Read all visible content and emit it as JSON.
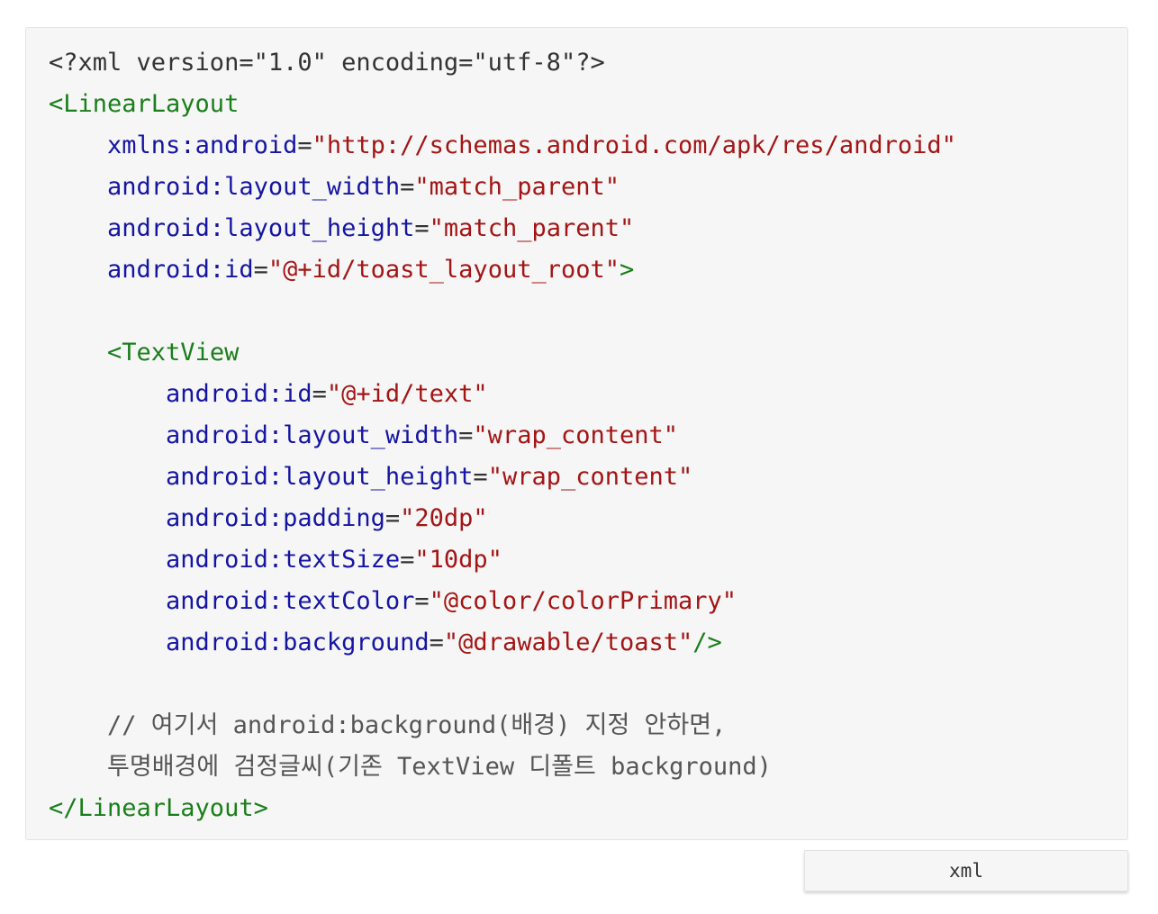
{
  "code_block": {
    "language": "xml",
    "colors": {
      "background": "#f6f6f6",
      "plain": "#333333",
      "tag": "#1a7f1a",
      "attribute": "#1515a3",
      "string": "#a31515",
      "comment": "#555555"
    },
    "lines": [
      [
        {
          "t": "plain",
          "v": "<?xml version=\"1.0\" encoding=\"utf-8\"?>"
        }
      ],
      [
        {
          "t": "tag",
          "v": "<LinearLayout"
        }
      ],
      [
        {
          "t": "plain",
          "v": "    "
        },
        {
          "t": "attr",
          "v": "xmlns:android"
        },
        {
          "t": "plain",
          "v": "="
        },
        {
          "t": "str",
          "v": "\"http://schemas.android.com/apk/res/android\""
        }
      ],
      [
        {
          "t": "plain",
          "v": "    "
        },
        {
          "t": "attr",
          "v": "android:layout_width"
        },
        {
          "t": "plain",
          "v": "="
        },
        {
          "t": "str",
          "v": "\"match_parent\""
        }
      ],
      [
        {
          "t": "plain",
          "v": "    "
        },
        {
          "t": "attr",
          "v": "android:layout_height"
        },
        {
          "t": "plain",
          "v": "="
        },
        {
          "t": "str",
          "v": "\"match_parent\""
        }
      ],
      [
        {
          "t": "plain",
          "v": "    "
        },
        {
          "t": "attr",
          "v": "android:id"
        },
        {
          "t": "plain",
          "v": "="
        },
        {
          "t": "str",
          "v": "\"@+id/toast_layout_root\""
        },
        {
          "t": "tag",
          "v": ">"
        }
      ],
      [],
      [
        {
          "t": "plain",
          "v": "    "
        },
        {
          "t": "tag",
          "v": "<TextView"
        }
      ],
      [
        {
          "t": "plain",
          "v": "        "
        },
        {
          "t": "attr",
          "v": "android:id"
        },
        {
          "t": "plain",
          "v": "="
        },
        {
          "t": "str",
          "v": "\"@+id/text\""
        }
      ],
      [
        {
          "t": "plain",
          "v": "        "
        },
        {
          "t": "attr",
          "v": "android:layout_width"
        },
        {
          "t": "plain",
          "v": "="
        },
        {
          "t": "str",
          "v": "\"wrap_content\""
        }
      ],
      [
        {
          "t": "plain",
          "v": "        "
        },
        {
          "t": "attr",
          "v": "android:layout_height"
        },
        {
          "t": "plain",
          "v": "="
        },
        {
          "t": "str",
          "v": "\"wrap_content\""
        }
      ],
      [
        {
          "t": "plain",
          "v": "        "
        },
        {
          "t": "attr",
          "v": "android:padding"
        },
        {
          "t": "plain",
          "v": "="
        },
        {
          "t": "str",
          "v": "\"20dp\""
        }
      ],
      [
        {
          "t": "plain",
          "v": "        "
        },
        {
          "t": "attr",
          "v": "android:textSize"
        },
        {
          "t": "plain",
          "v": "="
        },
        {
          "t": "str",
          "v": "\"10dp\""
        }
      ],
      [
        {
          "t": "plain",
          "v": "        "
        },
        {
          "t": "attr",
          "v": "android:textColor"
        },
        {
          "t": "plain",
          "v": "="
        },
        {
          "t": "str",
          "v": "\"@color/colorPrimary\""
        }
      ],
      [
        {
          "t": "plain",
          "v": "        "
        },
        {
          "t": "attr",
          "v": "android:background"
        },
        {
          "t": "plain",
          "v": "="
        },
        {
          "t": "str",
          "v": "\"@drawable/toast\""
        },
        {
          "t": "tag",
          "v": "/>"
        }
      ],
      [],
      [
        {
          "t": "plain",
          "v": "    "
        },
        {
          "t": "comment",
          "v": "// 여기서 android:background(배경) 지정 안하면,"
        }
      ],
      [
        {
          "t": "plain",
          "v": "    "
        },
        {
          "t": "comment",
          "v": "투명배경에 검정글씨(기존 TextView 디폴트 background)"
        }
      ],
      [
        {
          "t": "tag",
          "v": "</LinearLayout>"
        }
      ]
    ]
  },
  "language_label": "xml"
}
